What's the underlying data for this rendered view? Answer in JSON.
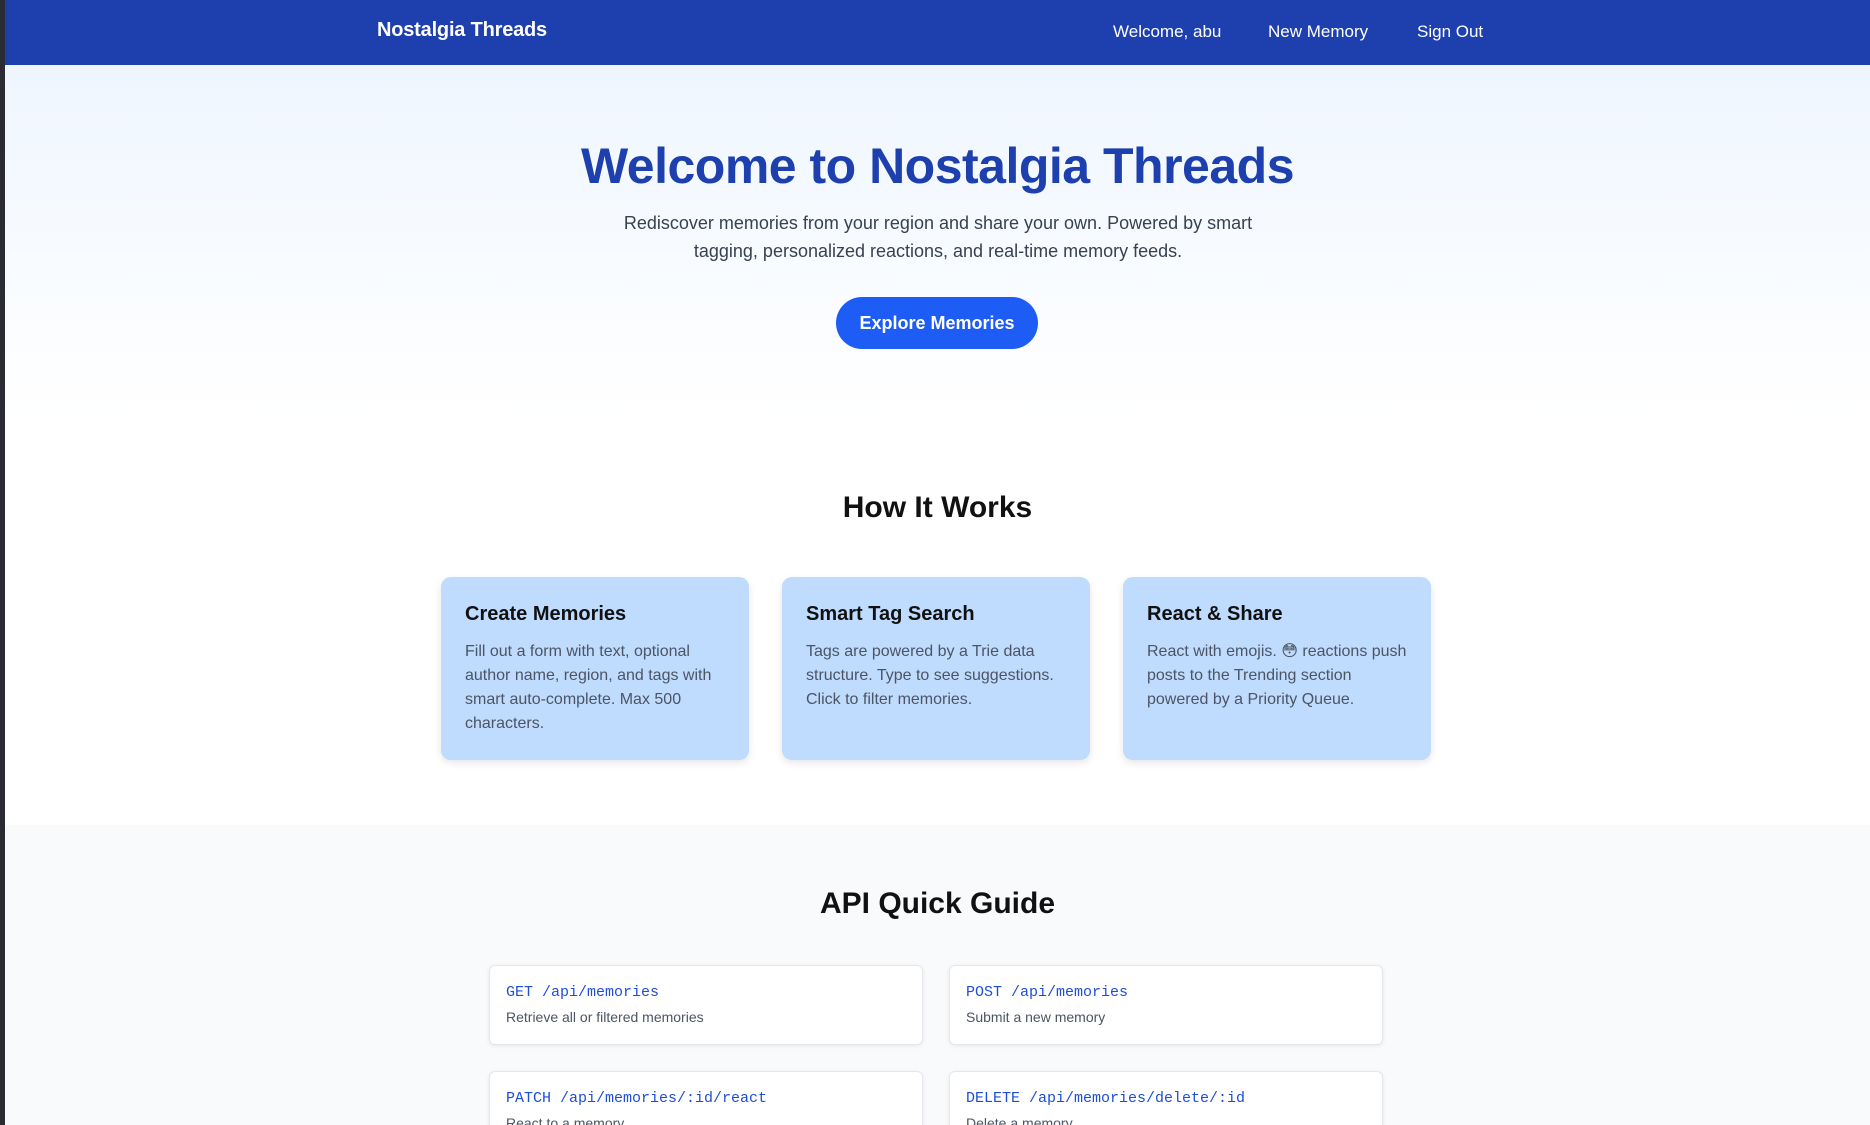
{
  "nav": {
    "brand": "Nostalgia Threads",
    "welcome": "Welcome, abu",
    "new_memory": "New Memory",
    "sign_out": "Sign Out"
  },
  "hero": {
    "title": "Welcome to Nostalgia Threads",
    "subtitle": "Rediscover memories from your region and share your own. Powered by smart tagging, personalized reactions, and real-time memory feeds.",
    "button": "Explore Memories"
  },
  "how": {
    "title": "How It Works",
    "cards": [
      {
        "title": "Create Memories",
        "text": "Fill out a form with text, optional author name, region, and tags with smart auto-complete. Max 500 characters."
      },
      {
        "title": "Smart Tag Search",
        "text": "Tags are powered by a Trie data structure. Type to see suggestions. Click to filter memories."
      },
      {
        "title": "React & Share",
        "text": "React with emojis. 😳 reactions push posts to the Trending section powered by a Priority Queue."
      }
    ]
  },
  "api": {
    "title": "API Quick Guide",
    "items": [
      {
        "endpoint": "GET /api/memories",
        "desc": "Retrieve all or filtered memories"
      },
      {
        "endpoint": "POST /api/memories",
        "desc": "Submit a new memory"
      },
      {
        "endpoint": "PATCH /api/memories/:id/react",
        "desc": "React to a memory"
      },
      {
        "endpoint": "DELETE /api/memories/delete/:id",
        "desc": "Delete a memory"
      }
    ]
  },
  "colors": {
    "nav_bg": "#1e40af",
    "accent": "#1d5cf5",
    "card_bg": "#bfdbfe",
    "endpoint_text": "#1d4ed8"
  }
}
